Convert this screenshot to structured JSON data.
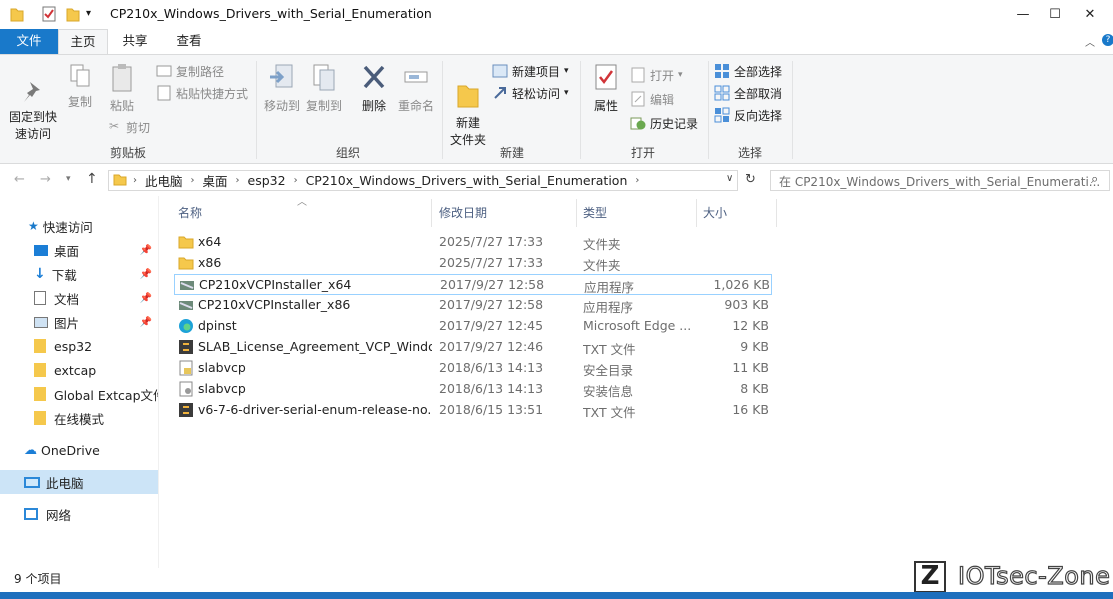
{
  "window": {
    "title": "CP210x_Windows_Drivers_with_Serial_Enumeration",
    "controls": {
      "minimize": "—",
      "maximize": "☐",
      "close": "✕"
    }
  },
  "tabs": {
    "file": "文件",
    "home": "主页",
    "share": "共享",
    "view": "查看"
  },
  "ribbon": {
    "clipboard": {
      "pin": "固定到快\n速访问",
      "copy": "复制",
      "paste": "粘贴",
      "copy_path": "复制路径",
      "paste_shortcut": "粘贴快捷方式",
      "cut": "剪切",
      "label": "剪贴板"
    },
    "organize": {
      "move_to": "移动到",
      "copy_to": "复制到",
      "delete": "删除",
      "rename": "重命名",
      "label": "组织"
    },
    "new": {
      "new_folder": "新建\n文件夹",
      "new_item": "新建项目",
      "easy_access": "轻松访问",
      "label": "新建"
    },
    "open": {
      "properties": "属性",
      "open": "打开",
      "edit": "编辑",
      "history": "历史记录",
      "label": "打开"
    },
    "select": {
      "select_all": "全部选择",
      "select_none": "全部取消",
      "invert": "反向选择",
      "label": "选择"
    }
  },
  "address": {
    "crumbs": [
      "此电脑",
      "桌面",
      "esp32",
      "CP210x_Windows_Drivers_with_Serial_Enumeration"
    ],
    "search_placeholder": "在 CP210x_Windows_Drivers_with_Serial_Enumerati..."
  },
  "nav": {
    "quick_access": "快速访问",
    "items": [
      "桌面",
      "下载",
      "文档",
      "图片",
      "esp32",
      "extcap",
      "Global Extcap文件",
      "在线模式"
    ],
    "onedrive": "OneDrive",
    "this_pc": "此电脑",
    "network": "网络"
  },
  "columns": {
    "name": "名称",
    "date": "修改日期",
    "type": "类型",
    "size": "大小"
  },
  "files": [
    {
      "name": "x64",
      "date": "2025/7/27 17:33",
      "type": "文件夹",
      "size": "",
      "icon": "folder-icon"
    },
    {
      "name": "x86",
      "date": "2025/7/27 17:33",
      "type": "文件夹",
      "size": "",
      "icon": "folder-icon"
    },
    {
      "name": "CP210xVCPInstaller_x64",
      "date": "2017/9/27 12:58",
      "type": "应用程序",
      "size": "1,026 KB",
      "icon": "installer-icon"
    },
    {
      "name": "CP210xVCPInstaller_x86",
      "date": "2017/9/27 12:58",
      "type": "应用程序",
      "size": "903 KB",
      "icon": "installer-icon"
    },
    {
      "name": "dpinst",
      "date": "2017/9/27 12:45",
      "type": "Microsoft Edge ...",
      "size": "12 KB",
      "icon": "edge-icon"
    },
    {
      "name": "SLAB_License_Agreement_VCP_Windo...",
      "date": "2017/9/27 12:46",
      "type": "TXT 文件",
      "size": "9 KB",
      "icon": "text-file-icon"
    },
    {
      "name": "slabvcp",
      "date": "2018/6/13 14:13",
      "type": "安全目录",
      "size": "11 KB",
      "icon": "security-catalog-icon"
    },
    {
      "name": "slabvcp",
      "date": "2018/6/13 14:13",
      "type": "安装信息",
      "size": "8 KB",
      "icon": "setup-info-icon"
    },
    {
      "name": "v6-7-6-driver-serial-enum-release-no...",
      "date": "2018/6/15 13:51",
      "type": "TXT 文件",
      "size": "16 KB",
      "icon": "text-file-icon"
    }
  ],
  "status": {
    "count": "9 个项目"
  },
  "watermark": "IOTsec-Zone"
}
